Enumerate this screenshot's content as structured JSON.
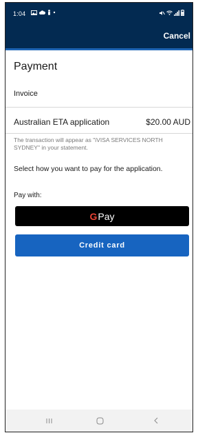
{
  "status_bar": {
    "time": "1:04",
    "left_icons": [
      "gallery-icon",
      "cloud-icon",
      "person-icon",
      "dot-icon"
    ],
    "right_icons": [
      "mute-icon",
      "wifi-icon",
      "signal-icon",
      "battery-icon"
    ]
  },
  "header": {
    "cancel_label": "Cancel",
    "background_color": "#032a51",
    "accent_color": "#1e64b4"
  },
  "main": {
    "title": "Payment",
    "invoice_label": "Invoice",
    "item": {
      "name": "Australian ETA application",
      "price": "$20.00 AUD"
    },
    "note": "The transaction will appear as \"iVISA SERVICES NORTH SYDNEY\" in your statement.",
    "instruction": "Select how you want to pay for the application.",
    "pay_with_label": "Pay with:"
  },
  "payment_buttons": {
    "gpay": {
      "g_letter": "G",
      "label": "Pay",
      "color": "#000000"
    },
    "credit_card": {
      "label": "Credit card",
      "color": "#1764c0"
    }
  },
  "nav_bar": {
    "buttons": [
      "recent-apps-icon",
      "home-icon",
      "back-icon"
    ]
  }
}
